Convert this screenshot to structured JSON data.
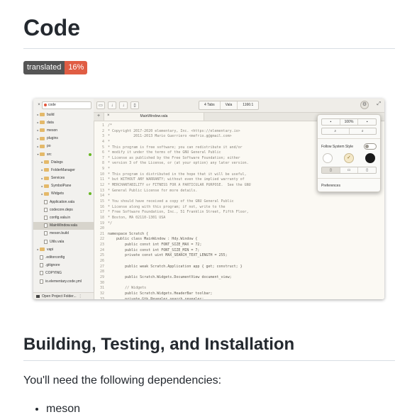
{
  "title": "Code",
  "badge": {
    "label": "translated",
    "value": "16%"
  },
  "screenshot": {
    "search_query": "code",
    "sidebar_items": [
      {
        "label": "build",
        "kind": "folder",
        "arrow": "▸",
        "indent": 1
      },
      {
        "label": "data",
        "kind": "folder",
        "arrow": "▸",
        "indent": 1
      },
      {
        "label": "meson",
        "kind": "folder",
        "arrow": "▸",
        "indent": 1
      },
      {
        "label": "plugins",
        "kind": "folder",
        "arrow": "▸",
        "indent": 1
      },
      {
        "label": "po",
        "kind": "folder",
        "arrow": "▸",
        "indent": 1
      },
      {
        "label": "src",
        "kind": "folder",
        "arrow": "▾",
        "indent": 1,
        "dot": true
      },
      {
        "label": "Dialogs",
        "kind": "folder",
        "arrow": "▸",
        "indent": 2
      },
      {
        "label": "FolderManager",
        "kind": "folder",
        "arrow": "▸",
        "indent": 2
      },
      {
        "label": "Services",
        "kind": "folder",
        "arrow": "▸",
        "indent": 2
      },
      {
        "label": "SymbolPane",
        "kind": "folder",
        "arrow": "▸",
        "indent": 2
      },
      {
        "label": "Widgets",
        "kind": "folder",
        "arrow": "▸",
        "indent": 2,
        "dot": true
      },
      {
        "label": "Application.vala",
        "kind": "file",
        "arrow": "",
        "indent": 2
      },
      {
        "label": "codecore.deps",
        "kind": "file",
        "arrow": "",
        "indent": 2
      },
      {
        "label": "config.vala.in",
        "kind": "file",
        "arrow": "",
        "indent": 2
      },
      {
        "label": "MainWindow.vala",
        "kind": "file",
        "arrow": "",
        "indent": 2,
        "selected": true
      },
      {
        "label": "meson.build",
        "kind": "file",
        "arrow": "",
        "indent": 2
      },
      {
        "label": "Utils.vala",
        "kind": "file",
        "arrow": "",
        "indent": 2
      },
      {
        "label": "vapi",
        "kind": "folder",
        "arrow": "▸",
        "indent": 1
      },
      {
        "label": ".editorconfig",
        "kind": "file",
        "arrow": "",
        "indent": 1
      },
      {
        "label": ".gitignore",
        "kind": "file",
        "arrow": "",
        "indent": 1
      },
      {
        "label": "COPYING",
        "kind": "file",
        "arrow": "",
        "indent": 1
      },
      {
        "label": "io.elementary.code.yml",
        "kind": "file",
        "arrow": "",
        "indent": 1
      }
    ],
    "open_folder_label": "Open Project Folder...",
    "toolbar_tabs_label": "4 Tabs",
    "toolbar_lang_label": "Vala",
    "toolbar_pos_label": "1166:1",
    "tab_label": "MainWindow.vala",
    "line_numbers": [
      "1",
      "2",
      "3",
      "4",
      "5",
      "6",
      "7",
      "8",
      "9",
      "10",
      "11",
      "12",
      "13",
      "14",
      "15",
      "16",
      "17",
      "18",
      "19",
      "20",
      "21",
      "22",
      "23",
      "24",
      "25",
      "26",
      "27",
      "28",
      "29",
      "30",
      "31",
      "32",
      "33"
    ],
    "code_lines": [
      "/*",
      "* Copyright 2017-2020 elementary, Inc. <https://elementary.io>",
      "*           2011-2013 Mario Guerriero <mefrio.g@gmail.com>",
      "*",
      "* This program is free software; you can redistribute it and/or",
      "* modify it under the terms of the GNU General Public",
      "* License as published by the Free Software Foundation; either",
      "* version 3 of the License, or (at your option) any later version.",
      "*",
      "* This program is distributed in the hope that it will be useful,",
      "* but WITHOUT ANY WARRANTY; without even the implied warranty of",
      "* MERCHANTABILITY or FITNESS FOR A PARTICULAR PURPOSE.  See the GNU",
      "* General Public License for more details.",
      "*",
      "* You should have received a copy of the GNU General Public",
      "* License along with this program; if not, write to the",
      "* Free Software Foundation, Inc., 51 Franklin Street, Fifth Floor,",
      "* Boston, MA 02110-1301 USA",
      "*/",
      "",
      "namespace Scratch {",
      "    public class MainWindow : Hdy.Window {",
      "        public const int FONT_SIZE_MAX = 72;",
      "        public const int FONT_SIZE_MIN = 7;",
      "        private const uint MAX_SEARCH_TEXT_LENGTH = 255;",
      "",
      "        public weak Scratch.Application app { get; construct; }",
      "",
      "        public Scratch.Widgets.DocumentView document_view;",
      "",
      "        // Widgets",
      "        public Scratch.Widgets.HeaderBar toolbar;",
      "        private Gtk.Revealer search_revealer;"
    ],
    "zoom_label": "100%",
    "follow_system_style_label": "Follow System Style",
    "preferences_label": "Preferences"
  },
  "section_heading": "Building, Testing, and Installation",
  "intro_text": "You'll need the following dependencies:",
  "dependencies": [
    "meson"
  ]
}
